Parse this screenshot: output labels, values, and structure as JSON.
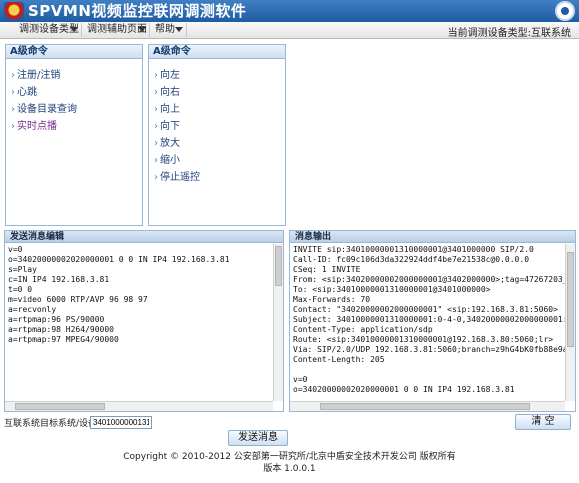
{
  "app": {
    "title": "SPVMN视频监控联网调测软件"
  },
  "menubar": {
    "menus": [
      {
        "label": "调测设备类型"
      },
      {
        "label": "调测辅助页面"
      },
      {
        "label": "帮助"
      }
    ],
    "current_device_type": "当前调测设备类型:互联系统"
  },
  "panel_left": {
    "title": "A级命令",
    "items": [
      {
        "label": "注册/注销"
      },
      {
        "label": "心跳"
      },
      {
        "label": "设备目录查询"
      },
      {
        "label": "实时点播"
      }
    ]
  },
  "panel_mid": {
    "title": "A级命令",
    "items": [
      {
        "label": "向左"
      },
      {
        "label": "向右"
      },
      {
        "label": "向上"
      },
      {
        "label": "向下"
      },
      {
        "label": "放大"
      },
      {
        "label": "缩小"
      },
      {
        "label": "停止遥控"
      }
    ]
  },
  "send_editor": {
    "title": "发送消息编辑",
    "content": "v=0\no=34020000002020000001 0 0 IN IP4 192.168.3.81\ns=Play\nc=IN IP4 192.168.3.81\nt=0 0\nm=video 6000 RTP/AVP 96 98 97\na=recvonly\na=rtpmap:96 PS/90000\na=rtpmap:98 H264/90000\na=rtpmap:97 MPEG4/90000"
  },
  "output_editor": {
    "title": "消息输出",
    "content": "INVITE sip:34010000001310000001@3401000000 SIP/2.0\nCall-ID: fc09c106d3da322924ddf4be7e21538c@0.0.0.0\nCSeq: 1 INVITE\nFrom: <sip:34020000002000000001@3402000000>;tag=47267203_\nTo: <sip:34010000001310000001@3401000000>\nMax-Forwards: 70\nContact: \"34020000002000000001\" <sip:192.168.3.81:5060>\nSubject: 34010000001310000001:0-4-0,34020000002000000001:\nContent-Type: application/sdp\nRoute: <sip:34010000001310000001@192.168.3.80:5060;lr>\nVia: SIP/2.0/UDP 192.168.3.81:5060;branch=z9hG4bK0fb88e9a\nContent-Length: 205\n\nv=0\no=34020000002020000001 0 0 IN IP4 192.168.3.81"
  },
  "target_field": {
    "label": "互联系统目标系统/设备ID:",
    "value": "34010000001310"
  },
  "buttons": {
    "send": "发送消息",
    "clear": "清 空"
  },
  "footer": {
    "copyright": "Copyright © 2010-2012 公安部第一研究所/北京中盾安全技术开发公司 版权所有",
    "version": "版本 1.0.0.1"
  }
}
